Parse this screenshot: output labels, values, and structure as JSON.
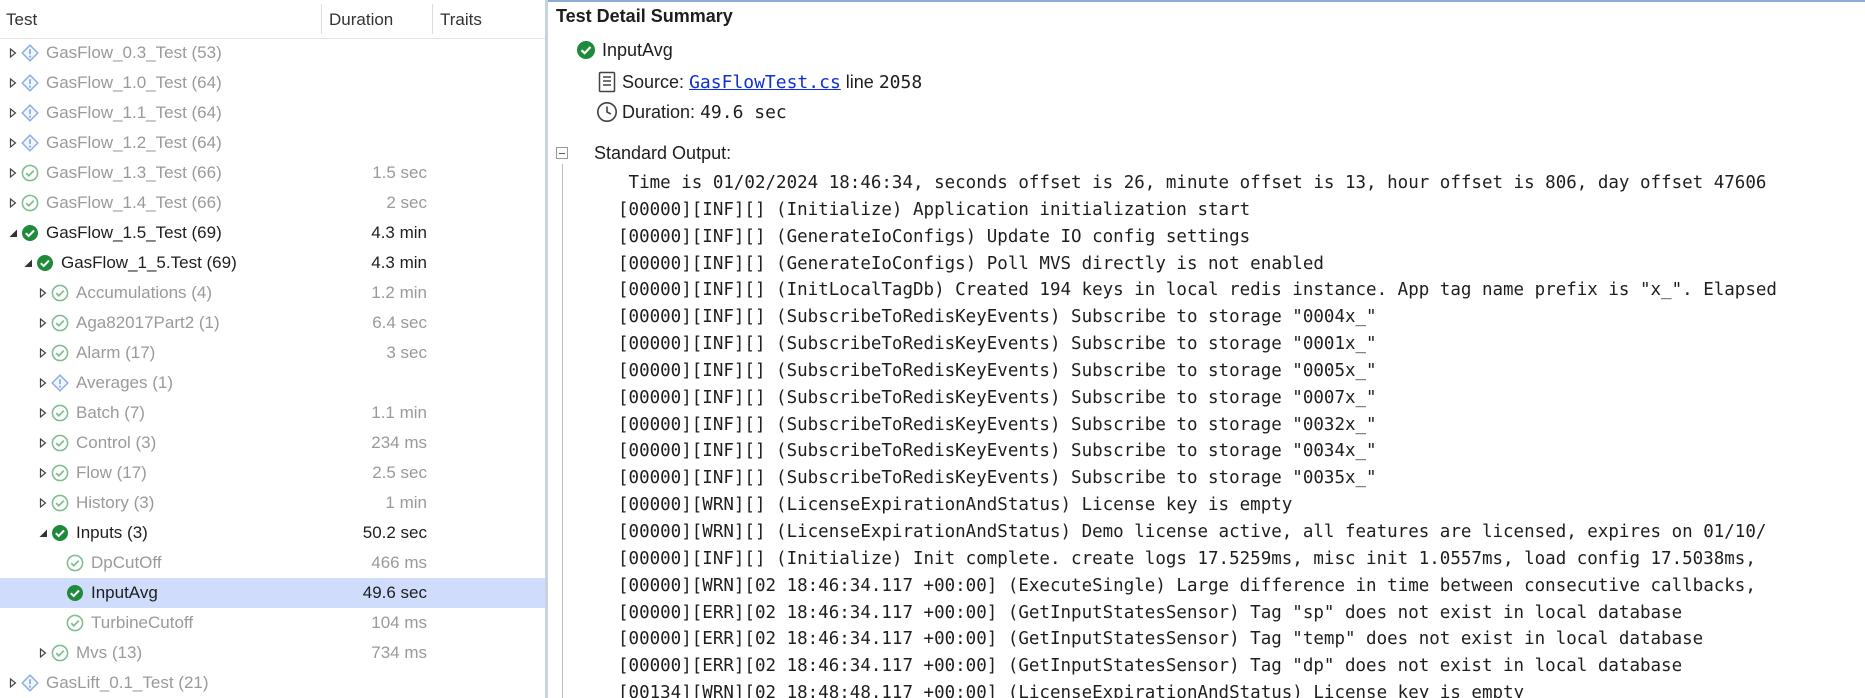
{
  "columns": {
    "test": "Test",
    "duration": "Duration",
    "traits": "Traits"
  },
  "tests": [
    {
      "name": "GasFlow_0.3_Test (53)",
      "duration": "",
      "level": 0,
      "status": "info",
      "expander": "closed",
      "dim": true,
      "selected": false
    },
    {
      "name": "GasFlow_1.0_Test (64)",
      "duration": "",
      "level": 0,
      "status": "info",
      "expander": "closed",
      "dim": true,
      "selected": false
    },
    {
      "name": "GasFlow_1.1_Test (64)",
      "duration": "",
      "level": 0,
      "status": "info",
      "expander": "closed",
      "dim": true,
      "selected": false
    },
    {
      "name": "GasFlow_1.2_Test (64)",
      "duration": "",
      "level": 0,
      "status": "info",
      "expander": "closed",
      "dim": true,
      "selected": false
    },
    {
      "name": "GasFlow_1.3_Test (66)",
      "duration": "1.5 sec",
      "level": 0,
      "status": "passed-outline",
      "expander": "closed",
      "dim": true,
      "selected": false
    },
    {
      "name": "GasFlow_1.4_Test (66)",
      "duration": "2 sec",
      "level": 0,
      "status": "passed-outline",
      "expander": "closed",
      "dim": true,
      "selected": false
    },
    {
      "name": "GasFlow_1.5_Test (69)",
      "duration": "4.3 min",
      "level": 0,
      "status": "passed",
      "expander": "open",
      "dim": false,
      "selected": false
    },
    {
      "name": "GasFlow_1_5.Test (69)",
      "duration": "4.3 min",
      "level": 1,
      "status": "passed",
      "expander": "open",
      "dim": false,
      "selected": false
    },
    {
      "name": "Accumulations (4)",
      "duration": "1.2 min",
      "level": 2,
      "status": "passed-outline",
      "expander": "closed",
      "dim": true,
      "selected": false
    },
    {
      "name": "Aga82017Part2 (1)",
      "duration": "6.4 sec",
      "level": 2,
      "status": "passed-outline",
      "expander": "closed",
      "dim": true,
      "selected": false
    },
    {
      "name": "Alarm (17)",
      "duration": "3 sec",
      "level": 2,
      "status": "passed-outline",
      "expander": "closed",
      "dim": true,
      "selected": false
    },
    {
      "name": "Averages (1)",
      "duration": "",
      "level": 2,
      "status": "info",
      "expander": "closed",
      "dim": true,
      "selected": false
    },
    {
      "name": "Batch (7)",
      "duration": "1.1 min",
      "level": 2,
      "status": "passed-outline",
      "expander": "closed",
      "dim": true,
      "selected": false
    },
    {
      "name": "Control (3)",
      "duration": "234 ms",
      "level": 2,
      "status": "passed-outline",
      "expander": "closed",
      "dim": true,
      "selected": false
    },
    {
      "name": "Flow (17)",
      "duration": "2.5 sec",
      "level": 2,
      "status": "passed-outline",
      "expander": "closed",
      "dim": true,
      "selected": false
    },
    {
      "name": "History (3)",
      "duration": "1 min",
      "level": 2,
      "status": "passed-outline",
      "expander": "closed",
      "dim": true,
      "selected": false
    },
    {
      "name": "Inputs (3)",
      "duration": "50.2 sec",
      "level": 2,
      "status": "passed",
      "expander": "open",
      "dim": false,
      "selected": false
    },
    {
      "name": "DpCutOff",
      "duration": "466 ms",
      "level": 3,
      "status": "passed-outline",
      "expander": "none",
      "dim": true,
      "selected": false
    },
    {
      "name": "InputAvg",
      "duration": "49.6 sec",
      "level": 3,
      "status": "passed",
      "expander": "none",
      "dim": false,
      "selected": true
    },
    {
      "name": "TurbineCutoff",
      "duration": "104 ms",
      "level": 3,
      "status": "passed-outline",
      "expander": "none",
      "dim": true,
      "selected": false
    },
    {
      "name": "Mvs (13)",
      "duration": "734 ms",
      "level": 2,
      "status": "passed-outline",
      "expander": "closed",
      "dim": true,
      "selected": false
    },
    {
      "name": "GasLift_0.1_Test (21)",
      "duration": "",
      "level": 0,
      "status": "info",
      "expander": "closed",
      "dim": true,
      "selected": false
    }
  ],
  "detail": {
    "title": "Test Detail Summary",
    "test_name": "InputAvg",
    "source_label": "Source:",
    "source_file": "GasFlowTest.cs",
    "line_label": "line",
    "line_number": "2058",
    "duration_label": "Duration:",
    "duration_value": "49.6 sec",
    "output_label": "Standard Output:",
    "output_lines": [
      " Time is 01/02/2024 18:46:34, seconds offset is 26, minute offset is 13, hour offset is 806, day offset 47606",
      "[00000][INF][] (Initialize) Application initialization start",
      "[00000][INF][] (GenerateIoConfigs) Update IO config settings",
      "[00000][INF][] (GenerateIoConfigs) Poll MVS directly is not enabled",
      "[00000][INF][] (InitLocalTagDb) Created 194 keys in local redis instance. App tag name prefix is \"x_\". Elapsed",
      "[00000][INF][] (SubscribeToRedisKeyEvents) Subscribe to storage \"0004x_\"",
      "[00000][INF][] (SubscribeToRedisKeyEvents) Subscribe to storage \"0001x_\"",
      "[00000][INF][] (SubscribeToRedisKeyEvents) Subscribe to storage \"0005x_\"",
      "[00000][INF][] (SubscribeToRedisKeyEvents) Subscribe to storage \"0007x_\"",
      "[00000][INF][] (SubscribeToRedisKeyEvents) Subscribe to storage \"0032x_\"",
      "[00000][INF][] (SubscribeToRedisKeyEvents) Subscribe to storage \"0034x_\"",
      "[00000][INF][] (SubscribeToRedisKeyEvents) Subscribe to storage \"0035x_\"",
      "[00000][WRN][] (LicenseExpirationAndStatus) License key is empty",
      "[00000][WRN][] (LicenseExpirationAndStatus) Demo license active, all features are licensed, expires on 01/10/",
      "[00000][INF][] (Initialize) Init complete. create logs 17.5259ms, misc init 1.0557ms, load config 17.5038ms,",
      "[00000][WRN][02 18:46:34.117 +00:00] (ExecuteSingle) Large difference in time between consecutive callbacks,",
      "[00000][ERR][02 18:46:34.117 +00:00] (GetInputStatesSensor) Tag \"sp\" does not exist in local database",
      "[00000][ERR][02 18:46:34.117 +00:00] (GetInputStatesSensor) Tag \"temp\" does not exist in local database",
      "[00000][ERR][02 18:46:34.117 +00:00] (GetInputStatesSensor) Tag \"dp\" does not exist in local database",
      "[00134][WRN][02 18:48:48.117 +00:00] (LicenseExpirationAndStatus) License key is empty"
    ]
  },
  "colors": {
    "passed": "#1e8a3c",
    "info": "#2f6fd6",
    "selected_row": "#cfdcfb",
    "link": "#0b31d6"
  }
}
